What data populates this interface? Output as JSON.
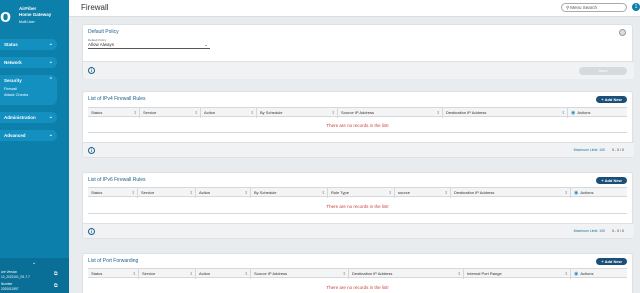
{
  "brand": {
    "logo": "io",
    "line1": "AirFiber",
    "line2": "Home Gateway",
    "line3": "Multi User"
  },
  "sidebar": {
    "items": [
      {
        "label": "Status"
      },
      {
        "label": "Network"
      },
      {
        "label": "Security",
        "subitems": [
          "Firewall",
          "Attack Checks"
        ]
      },
      {
        "label": "Administration"
      },
      {
        "label": "Advanced"
      }
    ],
    "footer": {
      "line1": "are Version",
      "line2": "10_2022101_R1.7.7",
      "line3": "Number",
      "line4": "2020011997"
    }
  },
  "header": {
    "title": "Firewall",
    "search_placeholder": "Menu Search",
    "avatar": "1"
  },
  "default_policy": {
    "title": "Default Policy",
    "field_label": "Default Policy",
    "value": "Allow Always",
    "save_label": "Save"
  },
  "ipv4": {
    "title": "List of IPv4 Firewall Rules",
    "add_label": "+ Add New",
    "columns": [
      "Status",
      "Service",
      "Action",
      "By Schedule",
      "Source IP Address",
      "Destination IP Address",
      "Actions"
    ],
    "empty": "There are no records in the list!",
    "max_limit": "Maximum Limit: 100",
    "pager": "0 - 0 / 0"
  },
  "ipv6": {
    "title": "List of IPv6 Firewall Rules",
    "add_label": "+ Add New",
    "columns": [
      "Status",
      "Service",
      "Action",
      "By Schedule",
      "Rule Type",
      "source",
      "Destination IP Address",
      "Actions"
    ],
    "empty": "There are no records in the list!",
    "max_limit": "Maximum Limit: 100",
    "pager": "0 - 0 / 0"
  },
  "port_forwarding": {
    "title": "List of Port Forwarding",
    "add_label": "+ Add New",
    "columns": [
      "Status",
      "Service",
      "Action",
      "Source IP Address",
      "Destination IP Address",
      "Internal Port Range",
      "Actions"
    ],
    "empty": "There are no records in the list!"
  },
  "colors": {
    "sidebar": "#0d7fab",
    "accent": "#1a4f79",
    "error": "#c7423b"
  }
}
